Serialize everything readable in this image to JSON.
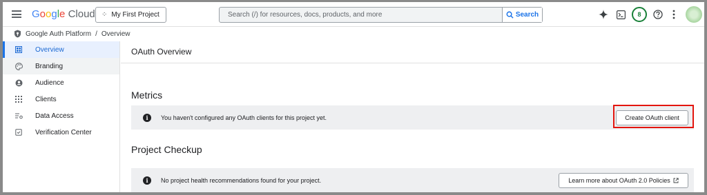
{
  "topbar": {
    "logo_google": [
      "G",
      "o",
      "o",
      "g",
      "l",
      "e"
    ],
    "logo_cloud": "Cloud",
    "project_label": "My First Project",
    "search_placeholder": "Search (/) for resources, docs, products, and more",
    "search_button": "Search",
    "notification_count": "8",
    "icons": [
      "menu-icon",
      "project-icon",
      "search-icon",
      "gemini-spark-icon",
      "cloud-shell-icon",
      "help-icon",
      "more-vert-icon"
    ]
  },
  "breadcrumb": {
    "items": [
      "Google Auth Platform",
      "Overview"
    ],
    "separator": "/"
  },
  "sidebar": {
    "items": [
      {
        "label": "Overview",
        "icon": "dashboard-icon"
      },
      {
        "label": "Branding",
        "icon": "palette-icon"
      },
      {
        "label": "Audience",
        "icon": "account-circle-icon"
      },
      {
        "label": "Clients",
        "icon": "grid-icon"
      },
      {
        "label": "Data Access",
        "icon": "list-settings-icon"
      },
      {
        "label": "Verification Center",
        "icon": "verified-icon"
      }
    ],
    "active": "Overview"
  },
  "main": {
    "title": "OAuth Overview",
    "metrics": {
      "heading": "Metrics",
      "message": "You haven't configured any OAuth clients for this project yet.",
      "button": "Create OAuth client"
    },
    "checkup": {
      "heading": "Project Checkup",
      "message": "No project health recommendations found for your project.",
      "button": "Learn more about OAuth 2.0 Policies"
    }
  },
  "colors": {
    "accent": "#1a73e8",
    "highlight_box": "#e3140d",
    "badge_green": "#188038"
  }
}
